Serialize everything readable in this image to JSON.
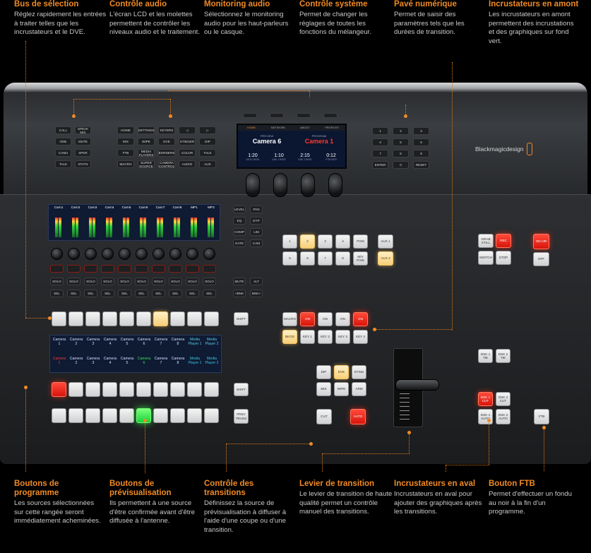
{
  "callouts": {
    "bus_selection": {
      "title": "Bus de sélection",
      "desc": "Réglez rapidement les entrées à traiter telles que les incrustateurs et le DVE."
    },
    "audio_control": {
      "title": "Contrôle audio",
      "desc": "L'écran LCD et les molettes permettent de contrôler les niveaux audio et le traitement."
    },
    "audio_monitoring": {
      "title": "Monitoring audio",
      "desc": "Sélectionnez le monitoring audio pour les haut-parleurs ou le casque."
    },
    "system_control": {
      "title": "Contrôle système",
      "desc": "Permet de changer les réglages de toutes les fonctions du mélangeur."
    },
    "numeric_pad": {
      "title": "Pavé numérique",
      "desc": "Permet de saisir des paramètres tels que les durées de transition."
    },
    "upstream_keyers": {
      "title": "Incrustateurs en amont",
      "desc": "Les incrustateurs en amont permettent des incrustations et des graphiques sur fond vert."
    },
    "program_buttons": {
      "title": "Boutons de programme",
      "desc": "Les sources sélectionnées sur cette rangée seront immédiatement acheminées."
    },
    "preview_buttons": {
      "title": "Boutons de prévisualisation",
      "desc": "Ils permettent à une source d'être confirmée avant d'être diffusée à l'antenne."
    },
    "transition_control": {
      "title": "Contrôle des transitions",
      "desc": "Définissez la source de prévisualisation à diffuser à l'aide d'une coupe ou d'une transition."
    },
    "transition_lever": {
      "title": "Levier de transition",
      "desc": "Le levier de transition de haute qualité permet un contrôle manuel des transitions."
    },
    "downstream_keyers": {
      "title": "Incrustateurs en aval",
      "desc": "Incrustateurs en aval pour ajouter des graphiques après les transitions."
    },
    "ftb_button": {
      "title": "Bouton FTB",
      "desc": "Permet d'effectuer un fondu au noir à la fin d'un programme."
    }
  },
  "top_keys": {
    "left": [
      "CALL",
      "SPEAK\nMIX",
      "ONE",
      "MUTE",
      "CAM4",
      "SPKR",
      "TALK",
      "STATS"
    ],
    "mid": [
      "HOME",
      "SETTINGS",
      "KEYERS",
      "◁",
      "▷",
      "MIX",
      "WIPE",
      "DVE",
      "STINGER",
      "DIP",
      "FTB",
      "MEDIA\nPLAYERS",
      "BORDERS",
      "COLOR",
      "TALK",
      "MACRO",
      "SUPER\nSOURCE",
      "CAMERA\nCONTROL",
      "AUDIO",
      "AUX"
    ],
    "numpad": [
      "1",
      "2",
      "3",
      "4",
      "5",
      "6",
      "7",
      "8",
      "9",
      "ENTER",
      "0",
      "RESET"
    ]
  },
  "lcd": {
    "menu": [
      "HOME",
      "NETWORK",
      "ABOUT",
      "PROFILES"
    ],
    "preview_label": "PREVIEW",
    "preview_value": "Camera 6",
    "program_label": "PROGRAM",
    "program_value": "Camera 1",
    "stats": [
      {
        "value": "1:20",
        "label": "AUTO RATE"
      },
      {
        "value": "1:10",
        "label": "DSK 1 RATE"
      },
      {
        "value": "2:15",
        "label": "DSK 2 RATE"
      },
      {
        "value": "0:12",
        "label": "FTB RATE"
      }
    ]
  },
  "brand": "Blackmagicdesign",
  "audio_channels": [
    "Cam1",
    "Cam2",
    "Cam3",
    "Cam4",
    "Cam5",
    "Cam6",
    "Cam7",
    "Cam8",
    "MP1",
    "MP2"
  ],
  "audio_side_keys": [
    "LEVEL",
    "PAN",
    "EQ",
    "DYP",
    "COMP",
    "LIM",
    "GATE",
    "CAM"
  ],
  "audio_row_keys": {
    "solo": "SOLO",
    "sel": "SEL",
    "mute": "MUTE",
    "alt": "ALT",
    "bank_down": "<BNK",
    "bank_up": "BNK>"
  },
  "source_names": [
    "Camera 1",
    "Camera 2",
    "Camera 3",
    "Camera 4",
    "Camera 5",
    "Camera 6",
    "Camera 7",
    "Camera 8",
    "Media Player 1",
    "Media Player 2"
  ],
  "shift": "SHIFT",
  "prev_trans": "PREV\nTRANS",
  "macro_pad": [
    "1",
    "2",
    "3",
    "4",
    "PGM",
    "5",
    "6",
    "7",
    "8",
    "M/V\nPVW"
  ],
  "aux_keys": [
    "AUX 1",
    "AUX 2"
  ],
  "keyer_row_top": [
    "MACRO",
    "ON",
    "ON",
    "ON",
    "ON"
  ],
  "keyer_row_bot": [
    "BKGD",
    "KEY 1",
    "KEY 2",
    "KEY 3",
    "KEY 4"
  ],
  "transition_keys": [
    "DIP",
    "DVE",
    "STING",
    "MIX",
    "WIPE",
    "ARM"
  ],
  "cut_auto": [
    "CUT",
    "AUTO"
  ],
  "record_keys": [
    "GRAB\nSTILL",
    "REC",
    "SWITCH",
    "STOP"
  ],
  "onair_keys": [
    "ON AIR",
    "OFF"
  ],
  "dsk_tie": [
    "DSK 1\nTIE",
    "DSK 2\nTIE"
  ],
  "dsk_cut": [
    "DSK 1\nCUT",
    "DSK 2\nCUT"
  ],
  "dsk_auto": [
    "DSK 1\nAUTO",
    "DSK 2\nAUTO"
  ],
  "ftb_key": "FTB",
  "colors": {
    "accent": "#f08a24",
    "red": "#e8180f",
    "amber": "#f7cf77",
    "green": "#1ad23a",
    "lcd": "#0b1631"
  }
}
